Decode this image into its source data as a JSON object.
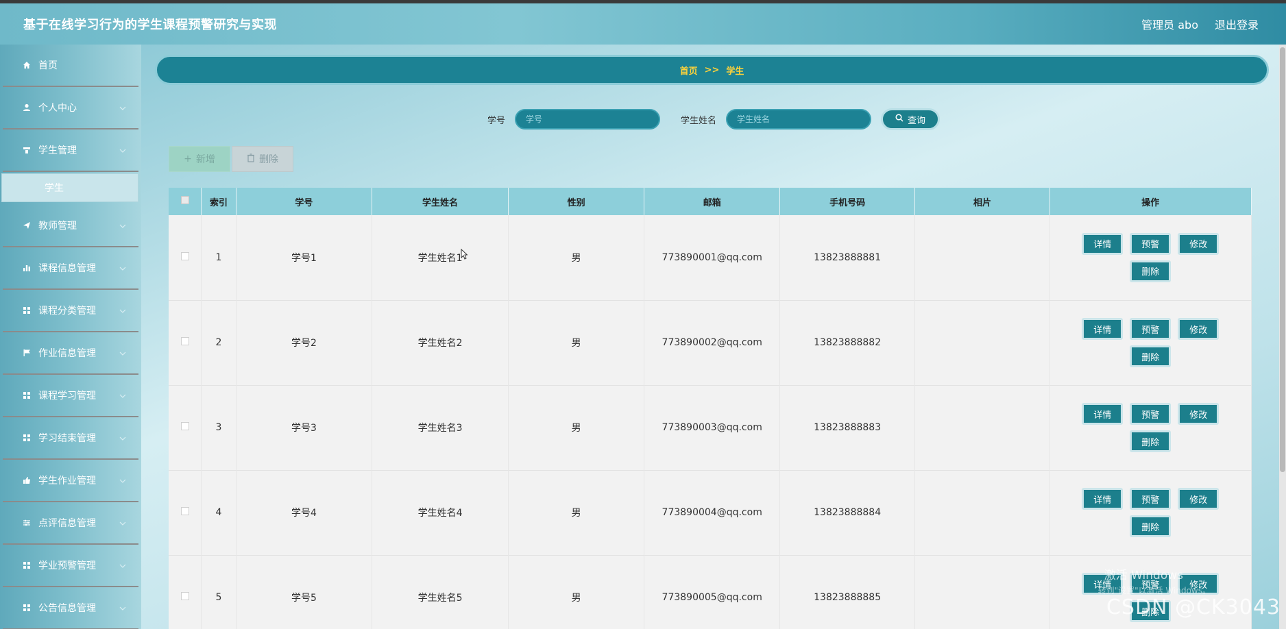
{
  "app": {
    "title": "基于在线学习行为的学生课程预警研究与实现",
    "user_label": "管理员 abo",
    "logout_label": "退出登录"
  },
  "sidebar": {
    "items": [
      {
        "label": "首页",
        "icon": "home-icon",
        "expandable": false
      },
      {
        "label": "个人中心",
        "icon": "user-icon",
        "expandable": true
      },
      {
        "label": "学生管理",
        "icon": "student-icon",
        "expandable": true,
        "children": [
          {
            "label": "学生",
            "active": true
          }
        ]
      },
      {
        "label": "教师管理",
        "icon": "send-icon",
        "expandable": true
      },
      {
        "label": "课程信息管理",
        "icon": "bar-chart-icon",
        "expandable": true
      },
      {
        "label": "课程分类管理",
        "icon": "grid-icon",
        "expandable": true
      },
      {
        "label": "作业信息管理",
        "icon": "flag-icon",
        "expandable": true
      },
      {
        "label": "课程学习管理",
        "icon": "grid-icon",
        "expandable": true
      },
      {
        "label": "学习结束管理",
        "icon": "grid-icon",
        "expandable": true
      },
      {
        "label": "学生作业管理",
        "icon": "thumb-icon",
        "expandable": true
      },
      {
        "label": "点评信息管理",
        "icon": "sliders-icon",
        "expandable": true
      },
      {
        "label": "学业预警管理",
        "icon": "grid-icon",
        "expandable": true
      },
      {
        "label": "公告信息管理",
        "icon": "grid-icon",
        "expandable": true
      }
    ]
  },
  "breadcrumb": {
    "home": "首页",
    "sep": ">>",
    "current": "学生"
  },
  "search": {
    "student_no_label": "学号",
    "student_no_placeholder": "学号",
    "student_name_label": "学生姓名",
    "student_name_placeholder": "学生姓名",
    "query_label": "查询"
  },
  "actions": {
    "add_label": "新增",
    "delete_label": "删除"
  },
  "table": {
    "columns": [
      "",
      "索引",
      "学号",
      "学生姓名",
      "性别",
      "邮箱",
      "手机号码",
      "相片",
      "操作"
    ],
    "row_actions": [
      "详情",
      "预警",
      "修改",
      "删除"
    ],
    "rows": [
      {
        "index": "1",
        "student_no": "学号1",
        "name": "学生姓名1",
        "gender": "男",
        "email": "773890001@qq.com",
        "phone": "13823888881",
        "photo": ""
      },
      {
        "index": "2",
        "student_no": "学号2",
        "name": "学生姓名2",
        "gender": "男",
        "email": "773890002@qq.com",
        "phone": "13823888882",
        "photo": ""
      },
      {
        "index": "3",
        "student_no": "学号3",
        "name": "学生姓名3",
        "gender": "男",
        "email": "773890003@qq.com",
        "phone": "13823888883",
        "photo": ""
      },
      {
        "index": "4",
        "student_no": "学号4",
        "name": "学生姓名4",
        "gender": "男",
        "email": "773890004@qq.com",
        "phone": "13823888884",
        "photo": ""
      },
      {
        "index": "5",
        "student_no": "学号5",
        "name": "学生姓名5",
        "gender": "男",
        "email": "773890005@qq.com",
        "phone": "13823888885",
        "photo": ""
      }
    ]
  },
  "watermarks": {
    "windows_line1": "激活 Windows",
    "windows_line2": "转到\"设置\"以激活 Windows。",
    "csdn": "CSDN @CK3043"
  },
  "colors": {
    "accent": "#1c8294",
    "header_bg": "#82c6d3",
    "breadcrumb_text": "#ffd33a",
    "table_header": "#8dcfda"
  }
}
